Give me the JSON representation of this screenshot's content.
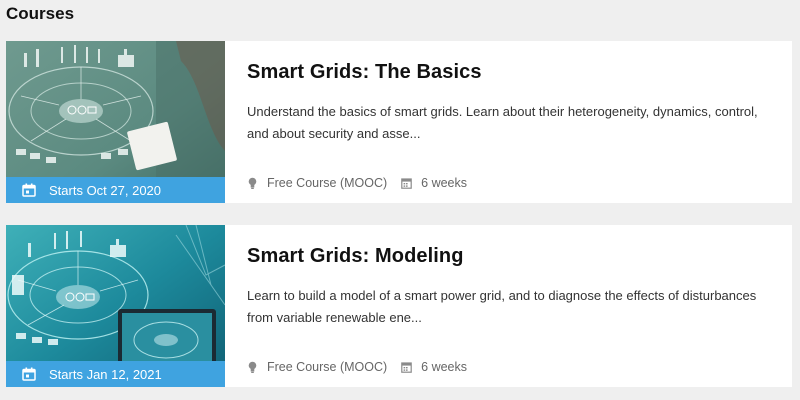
{
  "section": {
    "title": "Courses"
  },
  "courses": [
    {
      "title": "Smart Grids: The Basics",
      "description": "Understand the basics of smart grids. Learn about their heterogeneity, dynamics, control, and about security and asse...",
      "start": "Starts Oct 27, 2020",
      "type": "Free Course (MOOC)",
      "duration": "6 weeks"
    },
    {
      "title": "Smart Grids: Modeling",
      "description": "Learn to build a model of a smart power grid, and to diagnose the effects of disturbances from variable renewable ene...",
      "start": "Starts Jan 12, 2021",
      "type": "Free Course (MOOC)",
      "duration": "6 weeks"
    }
  ],
  "icons": {
    "calendar": "calendar-icon",
    "course_type": "lightbulb-icon",
    "duration": "calendar-small-icon"
  },
  "colors": {
    "date_bar": "#3fa3e0",
    "background": "#efefef"
  }
}
